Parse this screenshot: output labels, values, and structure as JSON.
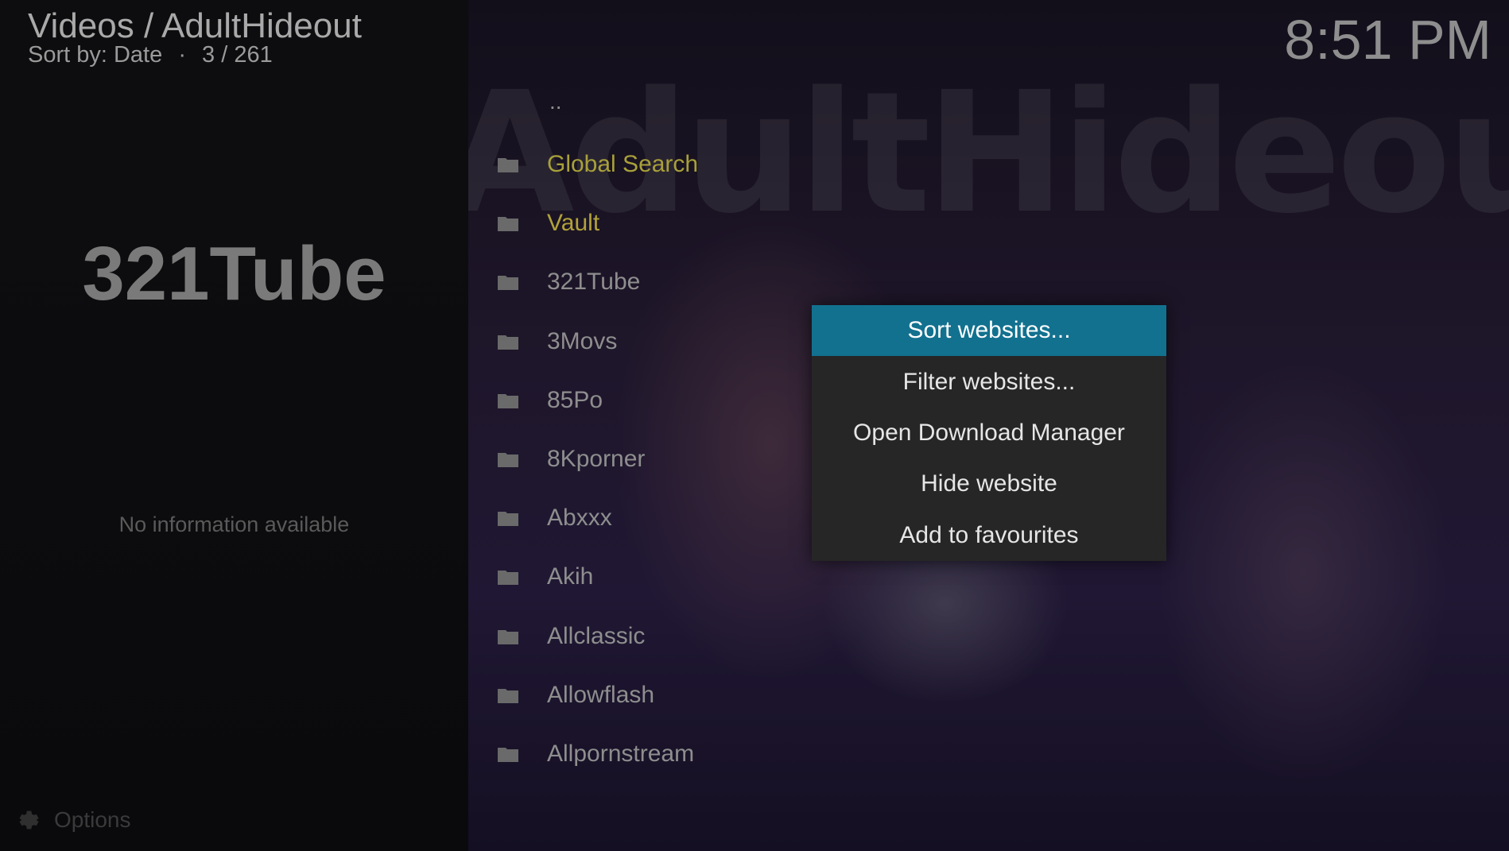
{
  "header": {
    "title": "Videos / AdultHideout",
    "sort_label": "Sort by: Date",
    "separator": "·",
    "position": "3 / 261",
    "clock": "8:51 PM"
  },
  "background": {
    "watermark": "AdultHideout"
  },
  "info_panel": {
    "title": "321Tube",
    "empty_text": "No information available",
    "options_label": "Options"
  },
  "list": {
    "parent_label": "..",
    "items": [
      {
        "label": "Global Search",
        "icon": "folder-icon"
      },
      {
        "label": "Vault",
        "icon": "folder-icon"
      },
      {
        "label": "321Tube",
        "icon": "folder-icon"
      },
      {
        "label": "3Movs",
        "icon": "folder-icon"
      },
      {
        "label": "85Po",
        "icon": "folder-icon"
      },
      {
        "label": "8Kporner",
        "icon": "folder-icon"
      },
      {
        "label": "Abxxx",
        "icon": "folder-icon"
      },
      {
        "label": "Akih",
        "icon": "folder-icon"
      },
      {
        "label": "Allclassic",
        "icon": "folder-icon"
      },
      {
        "label": "Allowflash",
        "icon": "folder-icon"
      },
      {
        "label": "Allpornstream",
        "icon": "folder-icon"
      }
    ]
  },
  "context_menu": {
    "items": [
      {
        "label": "Sort websites..."
      },
      {
        "label": "Filter websites..."
      },
      {
        "label": "Open Download Manager"
      },
      {
        "label": "Hide website"
      },
      {
        "label": "Add to favourites"
      }
    ],
    "selected_index": 0
  },
  "colors": {
    "accent": "#12718f",
    "highlight_text": "#a8a03a",
    "menu_bg": "#262626"
  }
}
